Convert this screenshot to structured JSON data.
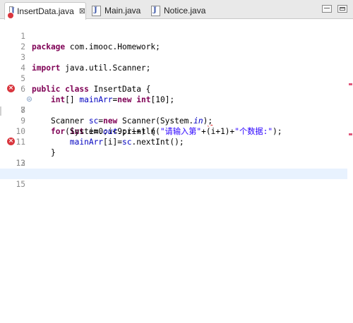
{
  "tabs": [
    {
      "label": "InsertData.java",
      "active": true,
      "has_error": true,
      "close": "⊠"
    },
    {
      "label": "Main.java",
      "active": false
    },
    {
      "label": "Notice.java",
      "active": false
    }
  ],
  "colors": {
    "keyword": "#7f0055",
    "string": "#2a00ff",
    "field": "#0000c0",
    "error": "#d9363e",
    "current_line": "#e8f2fe"
  },
  "editor": {
    "lines": [
      {
        "n": "1"
      },
      {
        "n": "2"
      },
      {
        "n": "3"
      },
      {
        "n": "4"
      },
      {
        "n": "5"
      },
      {
        "n": "6"
      },
      {
        "n": "7"
      },
      {
        "n": "8"
      },
      {
        "n": "9"
      },
      {
        "n": "10"
      },
      {
        "n": "11"
      },
      {
        "n": "12"
      },
      {
        "n": "13"
      },
      {
        "n": "14"
      },
      {
        "n": "15"
      }
    ],
    "tok": {
      "l1_kw": "package",
      "l1_rest": " com.imooc.Homework;",
      "l3_kw": "import",
      "l3_rest": " java.util.Scanner;",
      "l5_kw1": "public",
      "l5_sp": " ",
      "l5_kw2": "class",
      "l5_rest": " InsertData {",
      "l6_ind": "    ",
      "l6_kw1": "int",
      "l6_a": "[] ",
      "l6_fld": "mainArr",
      "l6_b": "=",
      "l6_kw2": "new",
      "l6_sp": " ",
      "l6_kw3": "int",
      "l6_c": "[10];",
      "l7_ind": "    ",
      "l7_a": "Scanner ",
      "l7_fld": "sc",
      "l7_b": "=",
      "l7_kw": "new",
      "l7_c": " Scanner(System.",
      "l7_in": "in",
      "l7_d": ")",
      "l7_err": ";",
      "l8_ind": "    ",
      "l8_kw1": "for",
      "l8_a": "(",
      "l8_kw2": "int",
      "l8_b": " i=0;i<9;i++) {",
      "l9_ind": "        ",
      "l9_a": "System.",
      "l9_out": "out",
      "l9_b": ".println(",
      "l9_s1": "\"请输入第\"",
      "l9_c": "+(i+1)+",
      "l9_s2": "\"个数据:\"",
      "l9_d": ");",
      "l10_ind": "        ",
      "l10_fld1": "mainArr",
      "l10_a": "[i]=",
      "l10_fld2": "sc",
      "l10_b": ".nextInt();",
      "l11_ind": "    ",
      "l11_a": "}",
      "l12_err": "}"
    }
  }
}
